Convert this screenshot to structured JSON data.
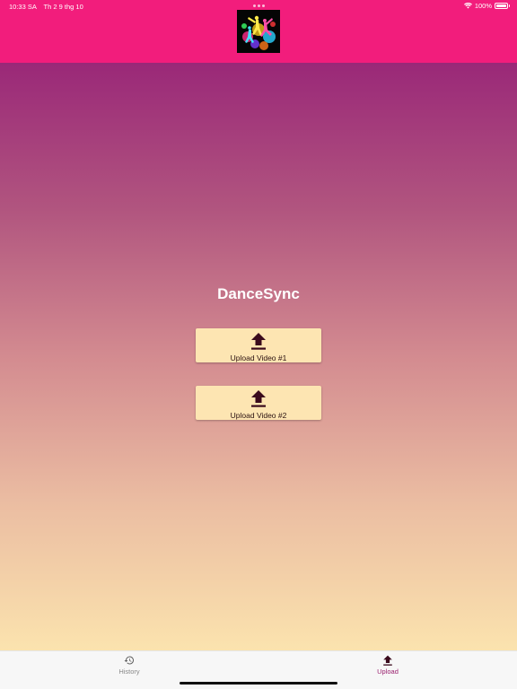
{
  "status_bar": {
    "time": "10:33 SA",
    "date": "Th 2 9 thg 10",
    "battery": "100%"
  },
  "header": {
    "logo_icon": "dancers-logo-icon"
  },
  "main": {
    "title": "DanceSync",
    "buttons": [
      {
        "label": "Upload Video #1",
        "icon": "upload-icon"
      },
      {
        "label": "Upload Video #2",
        "icon": "upload-icon"
      }
    ]
  },
  "tabbar": {
    "tabs": [
      {
        "label": "History",
        "icon": "history-icon",
        "active": false
      },
      {
        "label": "Upload",
        "icon": "upload-icon",
        "active": true
      }
    ]
  },
  "colors": {
    "header": "#f21d7c",
    "gradient_top": "#9a2878",
    "gradient_bottom": "#fbe3ae",
    "button": "#fde5b2",
    "icon_dark": "#3a0a1c",
    "active_tab": "#9a1f6e",
    "inactive_tab": "#8a8a8a"
  }
}
